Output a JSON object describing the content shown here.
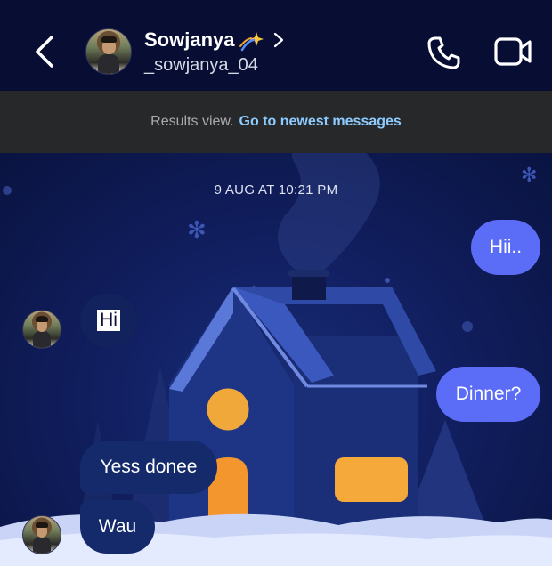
{
  "header": {
    "contact_name": "Sowjanya",
    "username": "_sowjanya_04"
  },
  "banner": {
    "label": "Results view.",
    "link": "Go to newest messages"
  },
  "chat": {
    "timestamp": "9 AUG AT 10:21 PM",
    "messages": [
      {
        "side": "outgoing",
        "text": "Hii.."
      },
      {
        "side": "incoming",
        "text": "Hi"
      },
      {
        "side": "outgoing",
        "text": "Dinner?"
      },
      {
        "side": "incoming",
        "text": "Yess donee"
      },
      {
        "side": "incoming",
        "text": "Wau"
      }
    ]
  },
  "icons": [
    "back-arrow-icon",
    "sparkle-emoji-icon",
    "chevron-right-icon",
    "phone-icon",
    "video-camera-icon"
  ],
  "colors": {
    "header_bg": "#080e33",
    "banner_bg": "#262829",
    "link": "#8ecbff",
    "outgoing_bubble": "#5b6cf7",
    "incoming_bubble": "#152a6b"
  }
}
